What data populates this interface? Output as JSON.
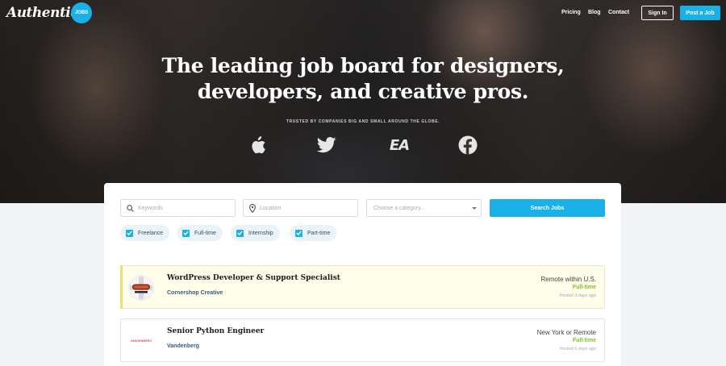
{
  "header": {
    "logo": "Authentic",
    "badge": "JOBS",
    "nav": [
      "Pricing",
      "Blog",
      "Contact"
    ],
    "signin_label": "Sign In",
    "post_label": "Post a Job"
  },
  "hero": {
    "headline_line1": "The leading job board for designers,",
    "headline_line2": "developers, and creative pros.",
    "trusted_text": "TRUSTED BY COMPANIES BIG AND SMALL AROUND THE GLOBE.",
    "brand_icons": [
      "apple-icon",
      "twitter-icon",
      "ea-logo",
      "facebook-icon"
    ],
    "ea_text": "EA"
  },
  "search": {
    "keywords_placeholder": "Keywords",
    "location_placeholder": "Location",
    "category_placeholder": "Choose a category...",
    "button_label": "Search Jobs"
  },
  "filters": [
    {
      "label": "Freelance",
      "checked": true
    },
    {
      "label": "Full-time",
      "checked": true
    },
    {
      "label": "Internship",
      "checked": true
    },
    {
      "label": "Part-time",
      "checked": true
    }
  ],
  "jobs": [
    {
      "title": "WordPress Developer & Support Specialist",
      "company": "Cornershop Creative",
      "location": "Remote within U.S.",
      "type": "Full-time",
      "posted": "Posted 3 days ago",
      "featured": true
    },
    {
      "title": "Senior Python Engineer",
      "company": "Vandenberg",
      "location": "New York or Remote",
      "type": "Full-time",
      "posted": "Posted 6 days ago",
      "featured": false,
      "logo_text": "VANDENBERG"
    }
  ],
  "colors": {
    "accent": "#1ab1e8",
    "fulltime": "#7cc12b",
    "featured_bg": "#fdfde9"
  }
}
